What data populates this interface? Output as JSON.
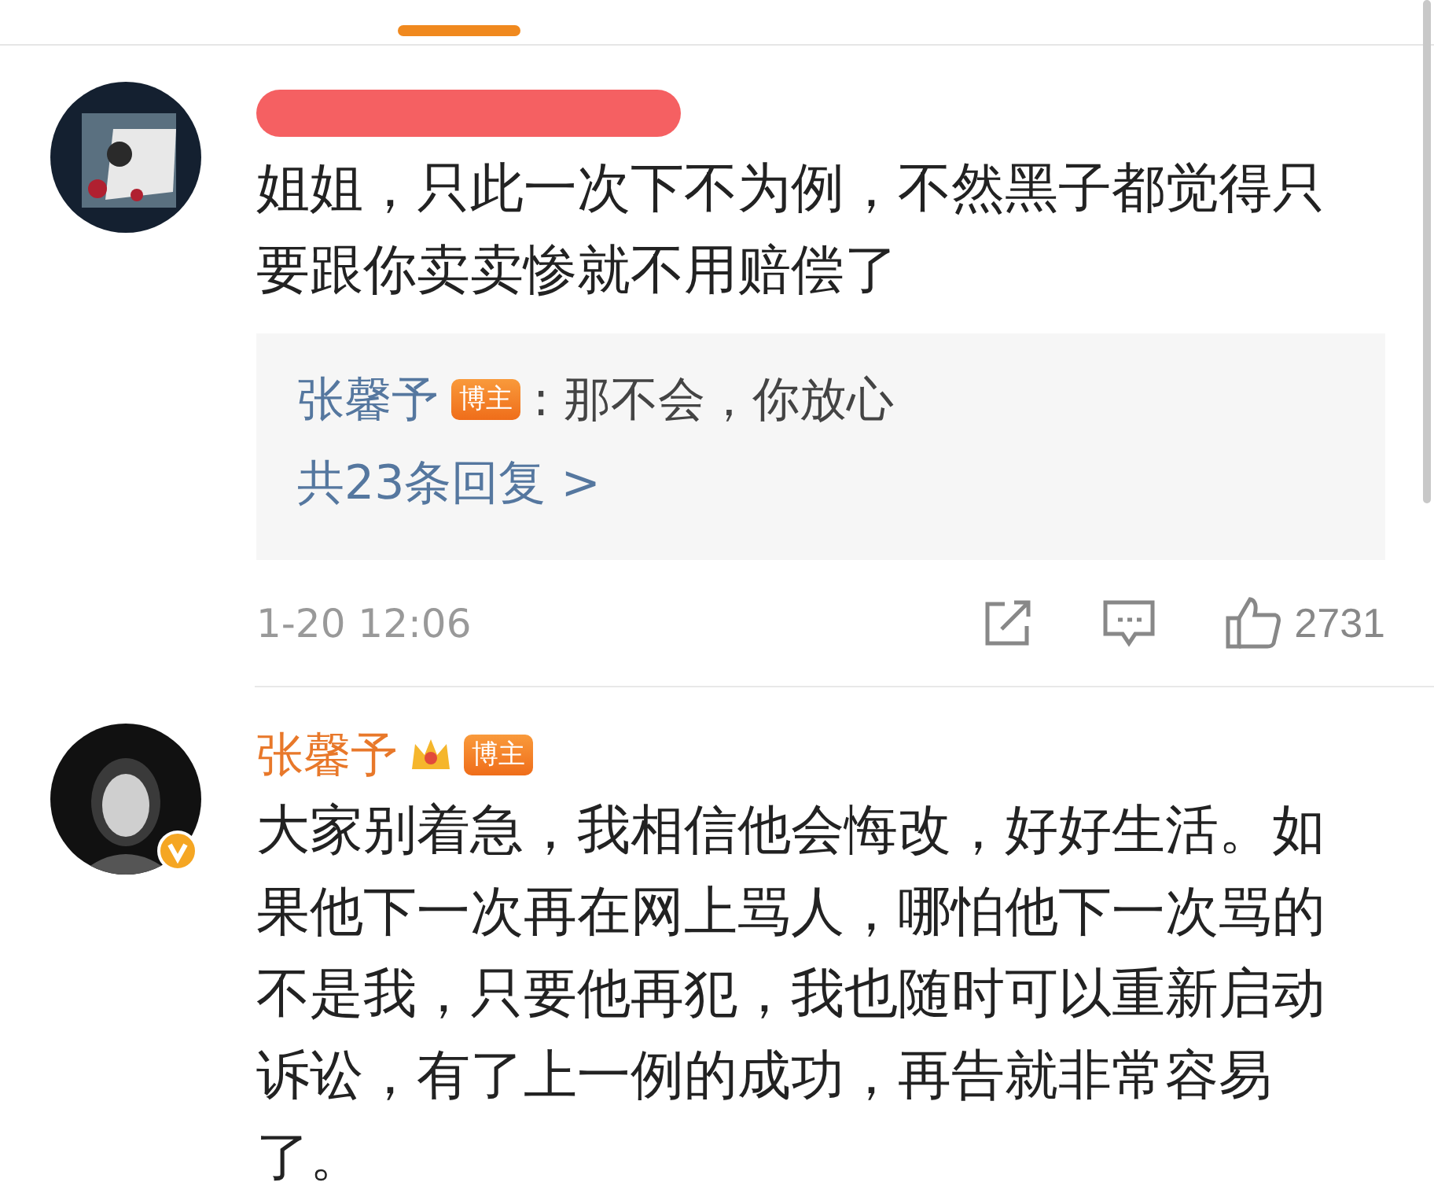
{
  "tabs_indicator": {
    "selected": true
  },
  "comments": [
    {
      "author": {
        "redacted": true,
        "verified": false
      },
      "text": "姐姐，只此一次下不为例，不然黑子都觉得只要跟你卖卖惨就不用赔偿了",
      "replies": [
        {
          "name": "张馨予",
          "badge": "博主",
          "text": ": 那不会，你放心"
        }
      ],
      "more_replies": "共23条回复 >",
      "time": "1-20 12:06",
      "likes": "2731"
    },
    {
      "author": {
        "name": "张馨予",
        "redacted": false,
        "verified": true,
        "badge": "博主"
      },
      "text": "大家别着急，我相信他会悔改，好好生活。如果他下一次再在网上骂人，哪怕他下一次骂的不是我，只要他再犯，我也随时可以重新启动诉讼，有了上一例的成功，再告就非常容易了。"
    }
  ]
}
